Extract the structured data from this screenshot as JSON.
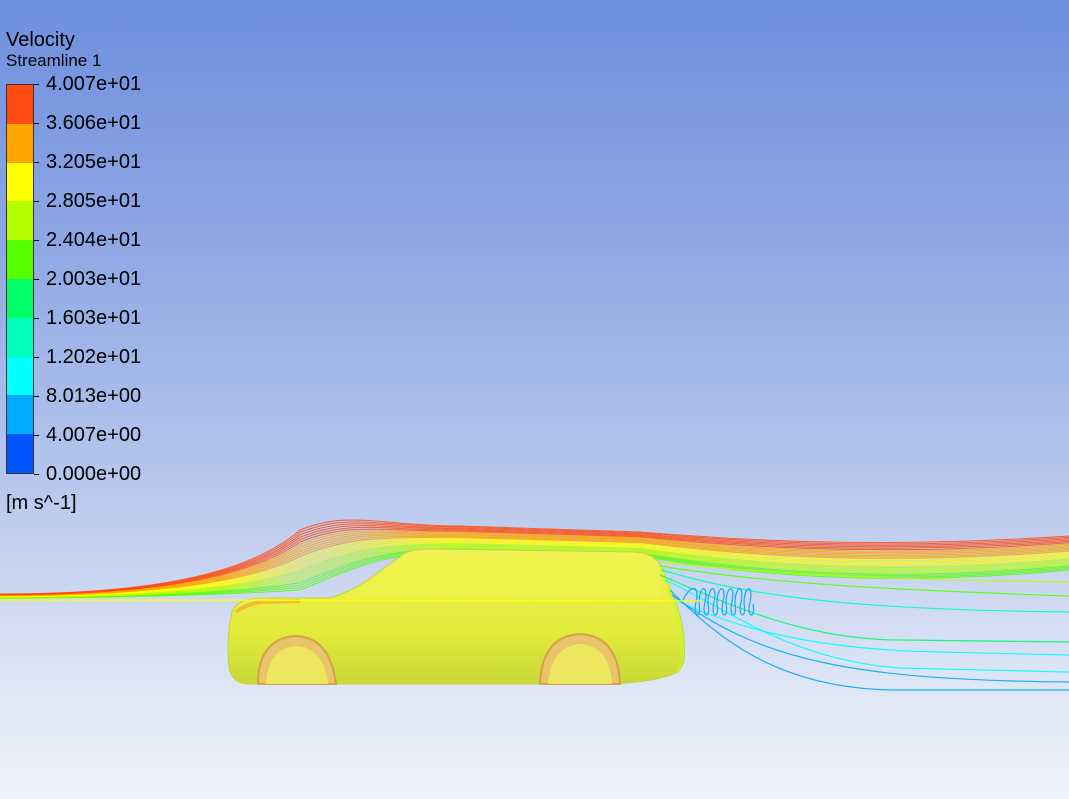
{
  "legend": {
    "title": "Velocity",
    "subtitle": "Streamline 1",
    "unit": "[m s^-1]",
    "ticks": [
      "4.007e+01",
      "3.606e+01",
      "3.205e+01",
      "2.805e+01",
      "2.404e+01",
      "2.003e+01",
      "1.603e+01",
      "1.202e+01",
      "8.013e+00",
      "4.007e+00",
      "0.000e+00"
    ],
    "colors": [
      "#ff4a12",
      "#ffa500",
      "#ffff00",
      "#b7ff00",
      "#55ff00",
      "#00ff66",
      "#00ffbb",
      "#00ffff",
      "#00aaff",
      "#0055ff"
    ]
  },
  "colors": {
    "background_top": "#6e8fdf",
    "background_bottom": "#eef2fb",
    "car_body": "#e8ef3a"
  }
}
